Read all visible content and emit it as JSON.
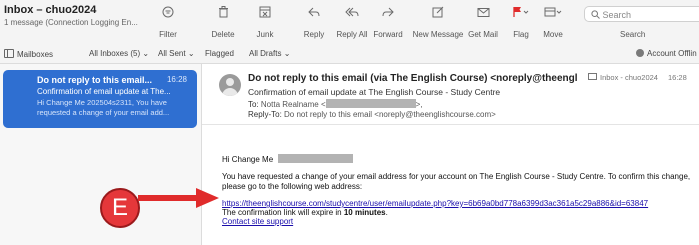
{
  "mailbox": {
    "title": "Inbox – chuo2024",
    "subtitle": "1 message (Connection Logging En..."
  },
  "toolbar": {
    "buttons": [
      {
        "label": "Filter",
        "icon": "filter-icon"
      },
      {
        "label": "Delete",
        "icon": "trash-icon"
      },
      {
        "label": "Junk",
        "icon": "junk-icon"
      },
      {
        "label": "Reply",
        "icon": "reply-icon"
      },
      {
        "label": "Reply All",
        "icon": "reply-all-icon"
      },
      {
        "label": "Forward",
        "icon": "forward-icon"
      },
      {
        "label": "New Message",
        "icon": "compose-icon"
      },
      {
        "label": "Get Mail",
        "icon": "envelope-icon"
      },
      {
        "label": "Flag",
        "icon": "flag-icon"
      },
      {
        "label": "Move",
        "icon": "move-tray-icon"
      }
    ],
    "search_placeholder": "Search",
    "search_label": "Search"
  },
  "favorites": {
    "mailboxes": "Mailboxes",
    "all_inboxes": "All Inboxes (5)",
    "all_sent": "All Sent",
    "flagged": "Flagged",
    "all_drafts": "All Drafts",
    "account_status": "Account Offlin"
  },
  "message_list": [
    {
      "sender": "Do not reply to this email...",
      "time": "16:28",
      "subject": "Confirmation of email update at The...",
      "preview": "Hi Change Me 202504s2311, You have requested a change of your email add..."
    }
  ],
  "message": {
    "from": "Do not reply to this email (via The English Course) <noreply@theenglish...",
    "subject": "Confirmation of email update at The English Course - Study Centre",
    "to_label": "To:",
    "to_name": "Notta Realname <",
    "to_end": ">,",
    "replyto_label": "Reply-To:",
    "replyto_value": "Do not reply to this email <noreply@theenglishcourse.com>",
    "mailbox_tag": "Inbox - chuo2024",
    "date": "16:28",
    "greeting": "Hi Change Me",
    "paragraph": "You have requested a change of your email address for your account on The English Course - Study Centre. To confirm this change, please go to the following web address:",
    "link": "https://theenglishcourse.com/studycentre/user/emailupdate.php?key=6b69a0bd778a6399d3ac361a5c29a886&id=63847",
    "expire_text": "The confirmation link will expire in ",
    "expire_strong": "10 minutes",
    "expire_end": ".",
    "support": "Contact site support"
  },
  "annotation": {
    "badge_letter": "E",
    "badge_color": "#e5373a"
  },
  "colors": {
    "selection": "#2f6fd1",
    "link": "#1a0dab",
    "flag": "#e02b2b"
  }
}
